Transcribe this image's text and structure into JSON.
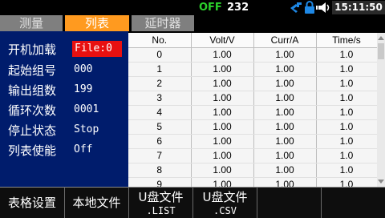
{
  "status": {
    "output_state": "OFF",
    "value": "232",
    "time": "15:11:50",
    "icons": [
      "usb-icon",
      "lock-icon",
      "speaker-icon"
    ],
    "colors": {
      "output_state": "#2bd12b",
      "time_bg": "#2a2a2a"
    }
  },
  "tabs": [
    {
      "label": "测量",
      "active": false
    },
    {
      "label": "列表",
      "active": true
    },
    {
      "label": "延时器",
      "active": false
    }
  ],
  "settings": {
    "power_on_load": {
      "label": "开机加载",
      "value": "File:0"
    },
    "start_group": {
      "label": "起始组号",
      "value": "000"
    },
    "output_groups": {
      "label": "输出组数",
      "value": "199"
    },
    "cycles": {
      "label": "循环次数",
      "value": "0001"
    },
    "stop_state": {
      "label": "停止状态",
      "value": "Stop"
    },
    "list_enable": {
      "label": "列表使能",
      "value": "Off"
    }
  },
  "table": {
    "columns": [
      "No.",
      "Volt/V",
      "Curr/A",
      "Time/s"
    ],
    "rows": [
      [
        "0",
        "1.00",
        "1.00",
        "1.0"
      ],
      [
        "1",
        "1.00",
        "1.00",
        "1.0"
      ],
      [
        "2",
        "1.00",
        "1.00",
        "1.0"
      ],
      [
        "3",
        "1.00",
        "1.00",
        "1.0"
      ],
      [
        "4",
        "1.00",
        "1.00",
        "1.0"
      ],
      [
        "5",
        "1.00",
        "1.00",
        "1.0"
      ],
      [
        "6",
        "1.00",
        "1.00",
        "1.0"
      ],
      [
        "7",
        "1.00",
        "1.00",
        "1.0"
      ],
      [
        "8",
        "1.00",
        "1.00",
        "1.0"
      ],
      [
        "9",
        "1.00",
        "1.00",
        "1.0"
      ]
    ]
  },
  "softkeys": [
    {
      "label": "表格设置"
    },
    {
      "label": "本地文件"
    },
    {
      "label": "U盘文件",
      "sub": ".LIST"
    },
    {
      "label": "U盘文件",
      "sub": ".CSV"
    },
    {
      "label": ""
    },
    {
      "label": ""
    }
  ],
  "theme": {
    "accent_tab": "#ff9a1f",
    "panel_bg": "#001c6c",
    "file_value_bg": "#e81010"
  }
}
